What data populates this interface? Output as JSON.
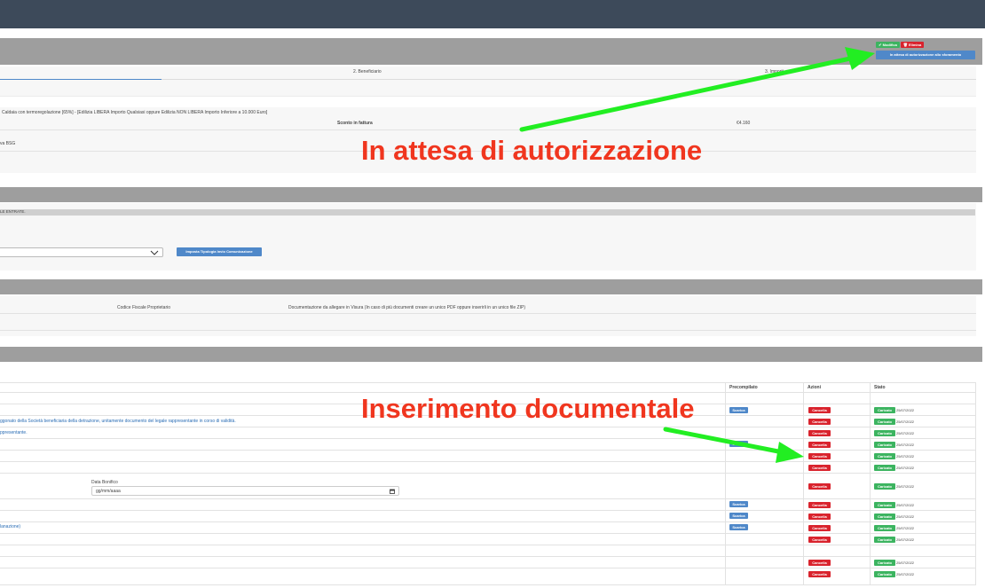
{
  "header": {},
  "section1": {
    "buttons": {
      "modifica": "✔ Modifica",
      "elimina": "🗑 Elimina"
    },
    "status_badge": "In attesa di autorizzazione allo sforamento",
    "tabs": [
      "2. Beneficiario",
      "3. Importi"
    ],
    "description": "Caldaia con termoregolazione [65%] - [Edilizia LIBERA Importo Qualsiasi oppure Edilizia NON LIBERA Importo Inferiore a 10.000 Euro]",
    "sconto_label": "Sconto in fattura",
    "sconto_value": "€4.160",
    "beneficiary_fragment": "va BSG"
  },
  "section2": {
    "entrate_fragment": "LE ENTRATE.",
    "set_button": "Imposta Tipologia Invio Comunicazione"
  },
  "section3": {
    "col_cf": "Codice Fiscale Proprietario",
    "col_doc": "Documentazione da allegare in Visura (In caso di più documenti creare un unico PDF oppure inserirli in un unico file ZIP)"
  },
  "section4": {
    "headers": {
      "precompilato": "Precompilato",
      "azioni": "Azioni",
      "stato": "Stato"
    },
    "link1": "ggonato della Società beneficiaria della detrazione, unitamente documento del legale rappresentante in corso di validità.",
    "link2": "ppresentante.",
    "link3": "lanazione)",
    "date_bonifico_label": "Data Bonifico",
    "date_placeholder": "gg/mm/aaaa",
    "scarica": "Scarica",
    "cancella": "Cancella",
    "caricato": "Caricato",
    "date": "25/07/2022"
  },
  "annotations": {
    "a1": "In attesa di autorizzazione",
    "a2": "Inserimento documentale"
  },
  "colors": {
    "arrow": "#22ee22",
    "annotation": "#f0361f",
    "topbar": "#3d4a5a"
  }
}
